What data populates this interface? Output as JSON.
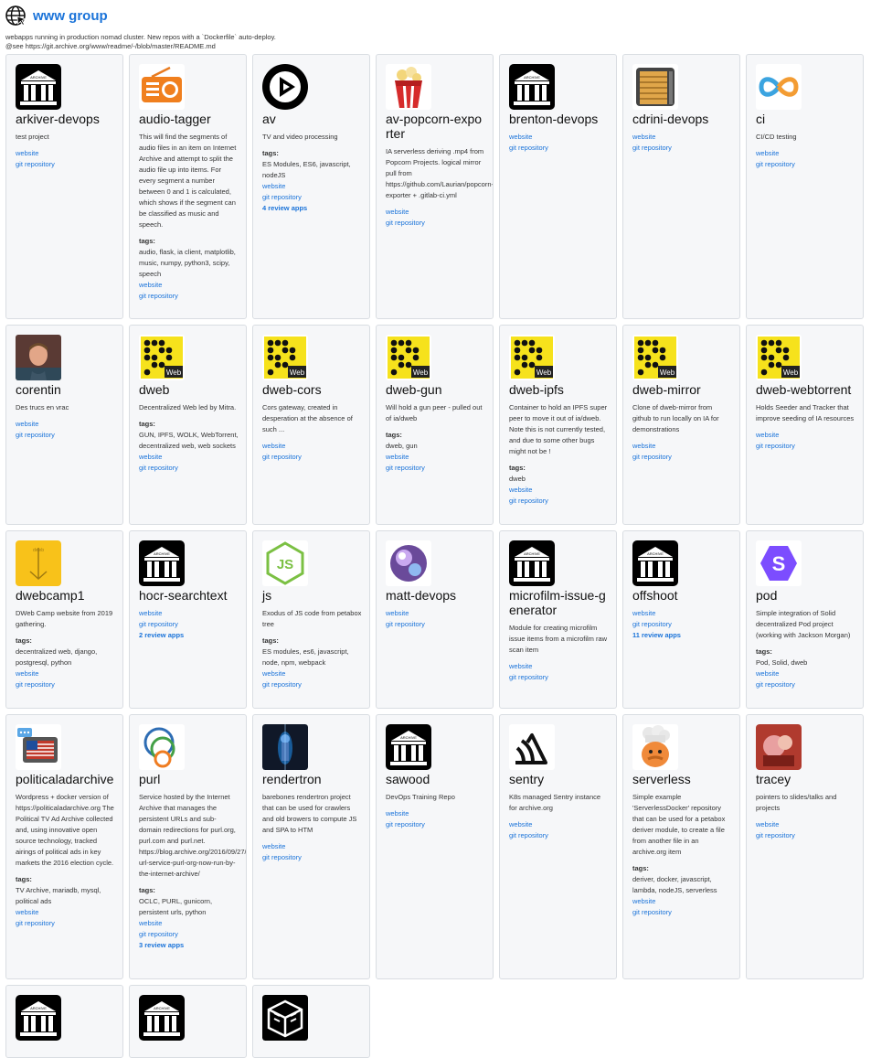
{
  "page": {
    "title": "www group",
    "description_lines": [
      "webapps running in production nomad cluster. New repos with a `Dockerfile` auto-deploy.",
      "@see https://git.archive.org/www/readme/-/blob/master/README.md"
    ]
  },
  "labels": {
    "tags": "tags:",
    "website": "website",
    "git": "git repository"
  },
  "projects": [
    {
      "name": "arkiver-devops",
      "icon": "archive-icon",
      "desc": "test project",
      "tags": "",
      "review": ""
    },
    {
      "name": "audio-tagger",
      "icon": "radio-icon",
      "desc": "This will find the segments of audio files in an item on Internet Archive and attempt to split the audio file up into items. For every segment a number between 0 and 1 is calculated, which shows if the segment can be classified as music and speech.",
      "tags": "audio, flask, ia client, matplotlib, music, numpy, python3, scipy, speech",
      "review": ""
    },
    {
      "name": "av",
      "icon": "play-icon",
      "desc": "TV and video processing",
      "tags": "ES Modules, ES6, javascript, nodeJS",
      "review": "4 review apps"
    },
    {
      "name": "av-popcorn-exporter",
      "icon": "popcorn-icon",
      "desc": "IA serverless deriving .mp4 from Popcorn Projects. logical mirror pull from https://github.com/Laurian/popcorn-exporter + .gitlab-ci.yml",
      "tags": "",
      "review": ""
    },
    {
      "name": "brenton-devops",
      "icon": "archive-icon",
      "desc": "",
      "tags": "",
      "review": ""
    },
    {
      "name": "cdrini-devops",
      "icon": "server-icon",
      "desc": "",
      "tags": "",
      "review": ""
    },
    {
      "name": "ci",
      "icon": "infinity-icon",
      "desc": "CI/CD testing",
      "tags": "",
      "review": ""
    },
    {
      "name": "corentin",
      "icon": "person-avatar-icon",
      "desc": "Des trucs en vrac",
      "tags": "",
      "review": ""
    },
    {
      "name": "dweb",
      "icon": "dweb-icon",
      "desc": "Decentralized Web led by Mitra.",
      "tags": "GUN, IPFS, WOLK, WebTorrent, decentralized web, web sockets",
      "review": ""
    },
    {
      "name": "dweb-cors",
      "icon": "dweb-icon",
      "desc": "Cors gateway, created in desperation at the absence of such ...",
      "tags": "",
      "review": ""
    },
    {
      "name": "dweb-gun",
      "icon": "dweb-icon",
      "desc": "Will hold a gun peer - pulled out of ia/dweb",
      "tags": "dweb, gun",
      "review": ""
    },
    {
      "name": "dweb-ipfs",
      "icon": "dweb-icon",
      "desc": "Container to hold an IPFS super peer to move it out of ia/dweb. Note this is not currently tested, and due to some other bugs might not be !",
      "tags": "dweb",
      "review": ""
    },
    {
      "name": "dweb-mirror",
      "icon": "dweb-icon",
      "desc": "Clone of dweb-mirror from github to run locally on IA for demonstrations",
      "tags": "",
      "review": ""
    },
    {
      "name": "dweb-webtorrent",
      "icon": "dweb-icon",
      "desc": "Holds Seeder and Tracker that improve seeding of IA resources",
      "tags": "",
      "review": ""
    },
    {
      "name": "dwebcamp1",
      "icon": "dwebcamp-icon",
      "desc": "DWeb Camp website from 2019 gathering.",
      "tags": "decentralized web, django, postgresql, python",
      "review": ""
    },
    {
      "name": "hocr-searchtext",
      "icon": "archive-icon",
      "desc": "",
      "tags": "",
      "review": "2 review apps"
    },
    {
      "name": "js",
      "icon": "nodejs-icon",
      "desc": "Exodus of JS code from petabox tree",
      "tags": "ES modules, es6, javascript, node, npm, webpack",
      "review": ""
    },
    {
      "name": "matt-devops",
      "icon": "disco-ball-icon",
      "desc": "",
      "tags": "",
      "review": ""
    },
    {
      "name": "microfilm-issue-generator",
      "icon": "archive-icon",
      "desc": "Module for creating microfilm issue items from a microfilm raw scan item",
      "tags": "",
      "review": ""
    },
    {
      "name": "offshoot",
      "icon": "archive-icon",
      "desc": "",
      "tags": "",
      "review": "11 review apps"
    },
    {
      "name": "pod",
      "icon": "pod-icon",
      "desc": "Simple integration of Solid decentralized Pod project (working with Jackson Morgan)",
      "tags": "Pod, Solid, dweb",
      "review": ""
    },
    {
      "name": "politicaladarchive",
      "icon": "tv-flag-icon",
      "desc": "Wordpress + docker version of https://politicaladarchive.org The Political TV Ad Archive collected and, using innovative open source technology, tracked airings of political ads in key markets the 2016 election cycle.",
      "tags": "TV Archive, mariadb, mysql, political ads",
      "review": ""
    },
    {
      "name": "purl",
      "icon": "purl-icon",
      "desc": "Service hosted by the Internet Archive that manages the persistent URLs and sub-domain redirections for purl.org, purl.com and purl.net. https://blog.archive.org/2016/09/27/persistent-url-service-purl-org-now-run-by-the-internet-archive/",
      "tags": "OCLC, PURL, gunicorn, persistent urls, python",
      "review": "3 review apps"
    },
    {
      "name": "rendertron",
      "icon": "rendertron-icon",
      "desc": "barebones rendertron project that can be used for crawlers and old browers to compute JS and SPA to HTM",
      "tags": "",
      "review": ""
    },
    {
      "name": "sawood",
      "icon": "archive-icon",
      "desc": "DevOps Training Repo",
      "tags": "",
      "review": ""
    },
    {
      "name": "sentry",
      "icon": "sentry-icon",
      "desc": "K8s managed Sentry instance for archive.org",
      "tags": "",
      "review": ""
    },
    {
      "name": "serverless",
      "icon": "chef-icon",
      "desc": "Simple example 'ServerlessDocker' repository that can be used for a petabox deriver module, to create a file from another file in an archive.org item",
      "tags": "deriver, docker, javascript, lambda, nodeJS, serverless",
      "review": ""
    },
    {
      "name": "tracey",
      "icon": "photo-avatar-icon",
      "desc": "pointers to slides/talks and projects",
      "tags": "",
      "review": ""
    },
    {
      "name": "",
      "icon": "archive-icon",
      "desc": "",
      "tags": "",
      "review": ""
    },
    {
      "name": "",
      "icon": "archive-icon",
      "desc": "",
      "tags": "",
      "review": ""
    },
    {
      "name": "",
      "icon": "cube-icon",
      "desc": "",
      "tags": "",
      "review": ""
    }
  ]
}
